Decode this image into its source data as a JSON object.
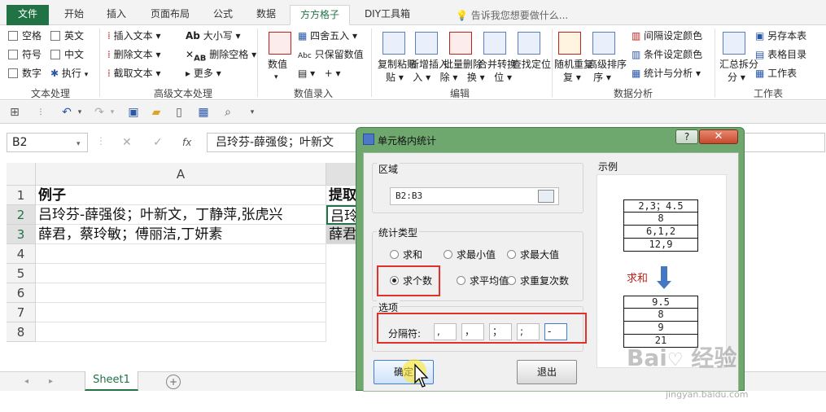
{
  "ribbon_tabs": [
    "文件",
    "开始",
    "插入",
    "页面布局",
    "公式",
    "数据",
    "方方格子",
    "DIY工具箱"
  ],
  "active_tab": "方方格子",
  "tell_me": "告诉我您想要做什么...",
  "ribbon": {
    "text_group": {
      "items": [
        "空格",
        "英文",
        "符号",
        "中文",
        "数字",
        "执行"
      ],
      "label": "文本处理"
    },
    "adv_group": {
      "items": [
        "插入文本",
        "删除文本",
        "截取文本",
        "大小写",
        "删除空格",
        "更多"
      ],
      "label": "高级文本处理"
    },
    "num_group": {
      "big": "数值",
      "items": [
        "四舍五入",
        "只保留数值"
      ],
      "label": "数值录入"
    },
    "edit_group": {
      "buttons": [
        "复制粘贴",
        "新增插入",
        "批量删除",
        "合并转换",
        "查找定位"
      ],
      "label": "编辑"
    },
    "analysis_group": {
      "buttons": [
        "随机重复",
        "高级排序"
      ],
      "items": [
        "间隔设定颜色",
        "条件设定颜色",
        "统计与分析"
      ],
      "label": "数据分析"
    },
    "work_group": {
      "buttons": [
        "汇总拆分"
      ],
      "items": [
        "另存本表",
        "表格目录",
        "工作表"
      ],
      "label": "工作表"
    }
  },
  "name_box": "B2",
  "formula": "吕玲芬-薛强俊；叶新文",
  "grid": {
    "columns": [
      "A"
    ],
    "rows": [
      "1",
      "2",
      "3",
      "4",
      "5",
      "6",
      "7",
      "8"
    ],
    "cells": {
      "A1": "例子",
      "A2": "吕玲芬-薛强俊；叶新文，丁静萍,张虎兴",
      "A3": "薛君，蔡玲敏；傅丽洁,丁妍素",
      "B1": "提取",
      "B2": "吕玲",
      "B3": "薛君"
    }
  },
  "sheet_tab": "Sheet1",
  "dialog": {
    "title": "单元格内统计",
    "help": "?",
    "close": "✕",
    "range_label": "区域",
    "range_value": "B2:B3",
    "type_label": "统计类型",
    "types": [
      "求和",
      "求最小值",
      "求最大值",
      "求个数",
      "求平均值",
      "求重复次数"
    ],
    "selected_type": "求个数",
    "options_label": "选项",
    "separator_label": "分隔符:",
    "separators": [
      ",",
      "，",
      "；",
      ";",
      "-"
    ],
    "ok": "确定",
    "exit": "退出",
    "example_label": "示例",
    "example_input": [
      "2,3；4.5",
      "8",
      "6,1,2",
      "12,9"
    ],
    "example_op": "求和",
    "example_output": [
      "9.5",
      "8",
      "9",
      "21"
    ]
  },
  "watermark": {
    "logo": "Bai 经验",
    "url": "jingyan.baidu.com"
  },
  "colors": {
    "excel_green": "#217346",
    "dialog_frame": "#6fa86f",
    "highlight_red": "#e0312d"
  }
}
